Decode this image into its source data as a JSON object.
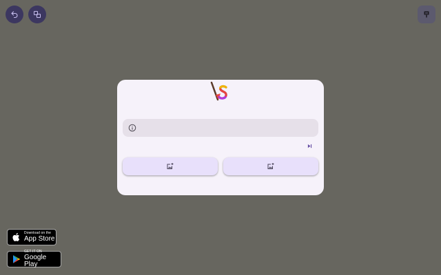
{
  "toolbar": {
    "undo_icon": "undo-icon",
    "swap_icon": "swap-icon",
    "corner_icon": "brush-icon"
  },
  "card": {
    "logo_icon": "app-logo",
    "info_icon": "info-icon",
    "info_text": "",
    "skip_icon": "skip-next-icon",
    "left_button_icon": "add-photo-icon",
    "right_button_icon": "add-photo-icon"
  },
  "badges": {
    "appstore_small": "Download on the",
    "appstore_big": "App Store",
    "googleplay_small": "GET IT ON",
    "googleplay_big": "Google Play"
  },
  "colors": {
    "background": "#67665f",
    "card": "#f6f2fa",
    "accent": "#3c3760",
    "button": "#e8e0fb"
  }
}
